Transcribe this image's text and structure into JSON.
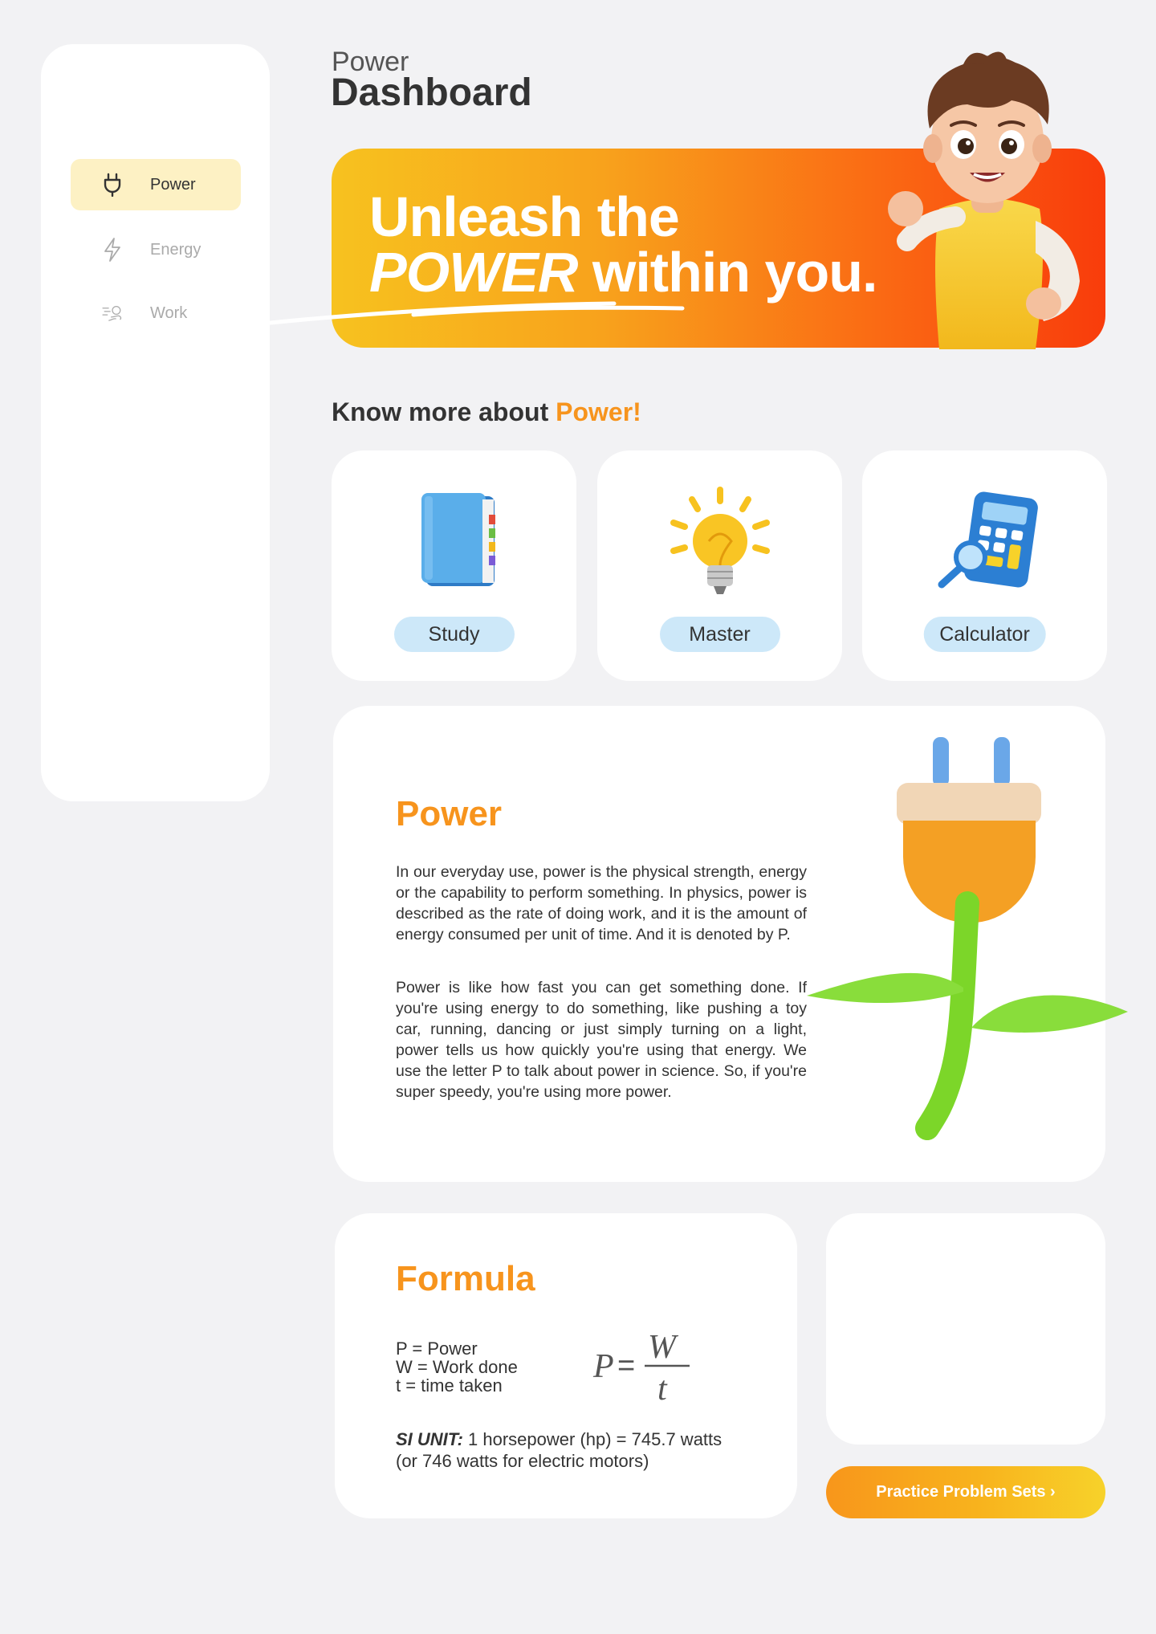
{
  "sidebar": {
    "items": [
      {
        "label": "Power",
        "icon": "plug-icon",
        "active": true
      },
      {
        "label": "Energy",
        "icon": "lightning-icon",
        "active": false
      },
      {
        "label": "Work",
        "icon": "wind-icon",
        "active": false
      }
    ]
  },
  "header": {
    "subtitle": "Power",
    "title": "Dashboard"
  },
  "banner": {
    "line1": "Unleash the",
    "line2_emphasis": "POWER",
    "line2_rest": " within you."
  },
  "section": {
    "heading_prefix": "Know more about ",
    "heading_accent": "Power!"
  },
  "cards": [
    {
      "label": "Study",
      "icon": "book-icon"
    },
    {
      "label": "Master",
      "icon": "lightbulb-icon"
    },
    {
      "label": "Calculator",
      "icon": "calculator-icon"
    }
  ],
  "info": {
    "title": "Power",
    "paragraph1": "In our everyday use, power is the physical strength, energy or the capability to perform something. In physics, power is described as the rate of doing work, and it is the amount of energy consumed per unit of time. And it is denoted by P.",
    "paragraph2": "Power is like how fast you can get something done. If you're using energy to do something, like pushing a toy car, running, dancing or just simply turning on a light, power tells us how quickly you're using that energy. We use the letter P to talk about power in science. So, if you're super speedy, you're using more power."
  },
  "formula": {
    "title": "Formula",
    "legend": [
      "P = Power",
      "W = Work done",
      "t = time taken"
    ],
    "equation": {
      "lhs": "P",
      "equals": "=",
      "numerator": "W",
      "denominator": "t"
    },
    "si_label": "SI UNIT:",
    "si_text": " 1 horsepower (hp) = 745.7 watts",
    "si_note": "(or 746 watts for electric motors)"
  },
  "cta": {
    "label": "Practice Problem Sets ›"
  },
  "colors": {
    "accent": "#f7941d",
    "active_nav": "#fdf1c4",
    "pill": "#cde8f9"
  }
}
